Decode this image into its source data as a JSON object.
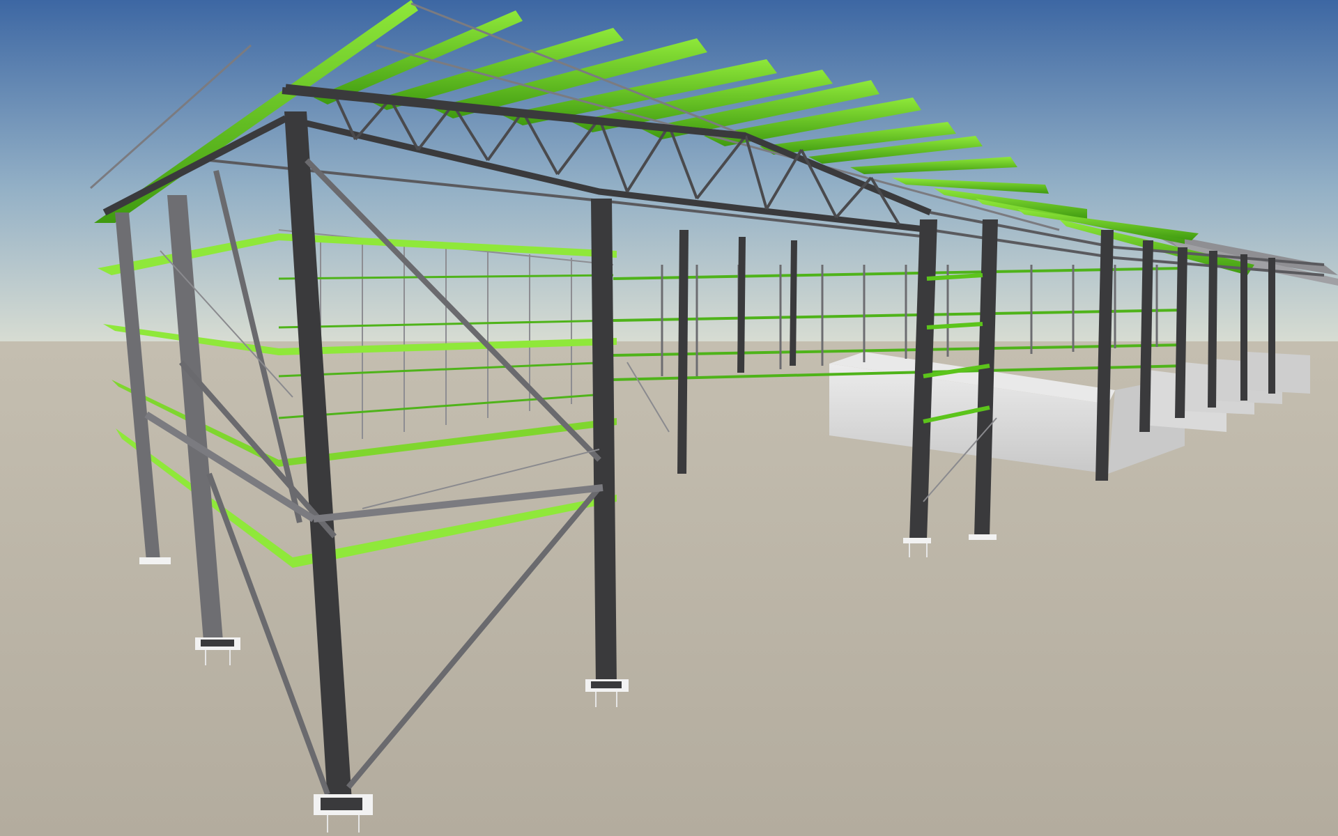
{
  "scene": {
    "subject": "steel-frame-building-3d-model",
    "colors": {
      "sky_top": "#3d67a3",
      "sky_mid": "#93b0c6",
      "horizon": "#d7dcd2",
      "ground": "#b5aea0",
      "ground_far": "#c4beb0",
      "steel_dark": "#3a3a3c",
      "steel_mid": "#5b5b5e",
      "steel_light": "#8c8c90",
      "purlin_green": "#5cc41b",
      "purlin_green_light": "#8fe83a",
      "purlin_green_dark": "#3f8f10",
      "concrete": "#dcdcdc",
      "concrete_shadow": "#b9b9b9",
      "baseplate": "#f2f2f2"
    }
  }
}
